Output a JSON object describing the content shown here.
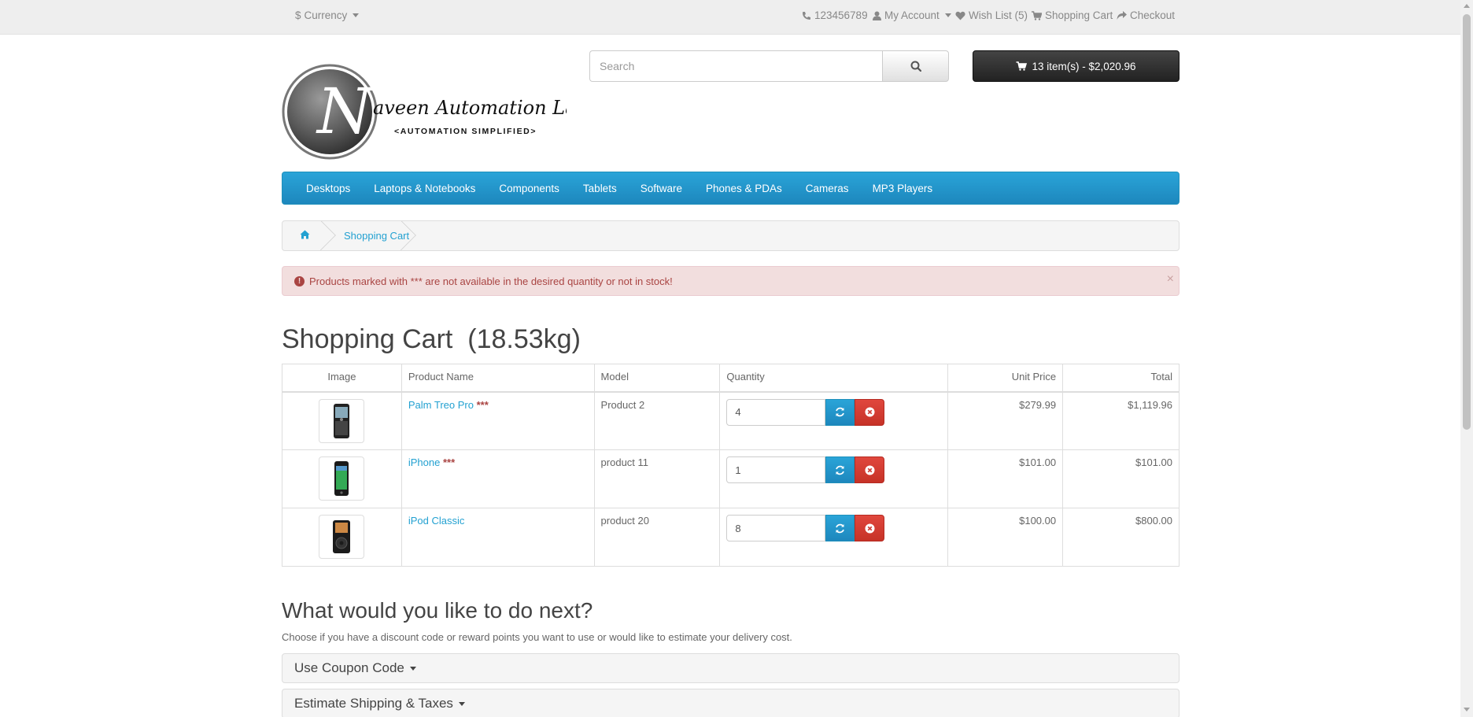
{
  "topbar": {
    "currency": "Currency",
    "currency_symbol": "$",
    "phone": "123456789",
    "my_account": "My Account",
    "wish_list": "Wish List (5)",
    "shopping_cart": "Shopping Cart",
    "checkout": "Checkout"
  },
  "header": {
    "logo_letter": "N",
    "logo_title": "aveen Automation Labs",
    "logo_subtitle": "<AUTOMATION SIMPLIFIED>",
    "search_placeholder": "Search",
    "cart_button": "13 item(s) - $2,020.96"
  },
  "menu": [
    "Desktops",
    "Laptops & Notebooks",
    "Components",
    "Tablets",
    "Software",
    "Phones & PDAs",
    "Cameras",
    "MP3 Players"
  ],
  "breadcrumb": {
    "current": "Shopping Cart"
  },
  "alert": {
    "message": "Products marked with *** are not available in the desired quantity or not in stock!",
    "close": "×"
  },
  "cart": {
    "title": "Shopping Cart  (18.53kg)",
    "headers": {
      "image": "Image",
      "name": "Product Name",
      "model": "Model",
      "quantity": "Quantity",
      "unit_price": "Unit Price",
      "total": "Total"
    },
    "rows": [
      {
        "name": "Palm Treo Pro",
        "stock_flag": "***",
        "model": "Product 2",
        "quantity": "4",
        "unit_price": "$279.99",
        "total": "$1,119.96",
        "thumb": "palm-phone"
      },
      {
        "name": "iPhone",
        "stock_flag": "***",
        "model": "product 11",
        "quantity": "1",
        "unit_price": "$101.00",
        "total": "$101.00",
        "thumb": "iphone"
      },
      {
        "name": "iPod Classic",
        "stock_flag": "",
        "model": "product 20",
        "quantity": "8",
        "unit_price": "$100.00",
        "total": "$800.00",
        "thumb": "ipod"
      }
    ]
  },
  "next": {
    "title": "What would you like to do next?",
    "description": "Choose if you have a discount code or reward points you want to use or would like to estimate your delivery cost.",
    "panels": [
      "Use Coupon Code",
      "Estimate Shipping & Taxes"
    ]
  },
  "colors": {
    "accent": "#23a1d1",
    "menu": "#229ac8",
    "alert_bg": "#f2dede",
    "alert_text": "#a94442",
    "remove": "#da4f49"
  }
}
